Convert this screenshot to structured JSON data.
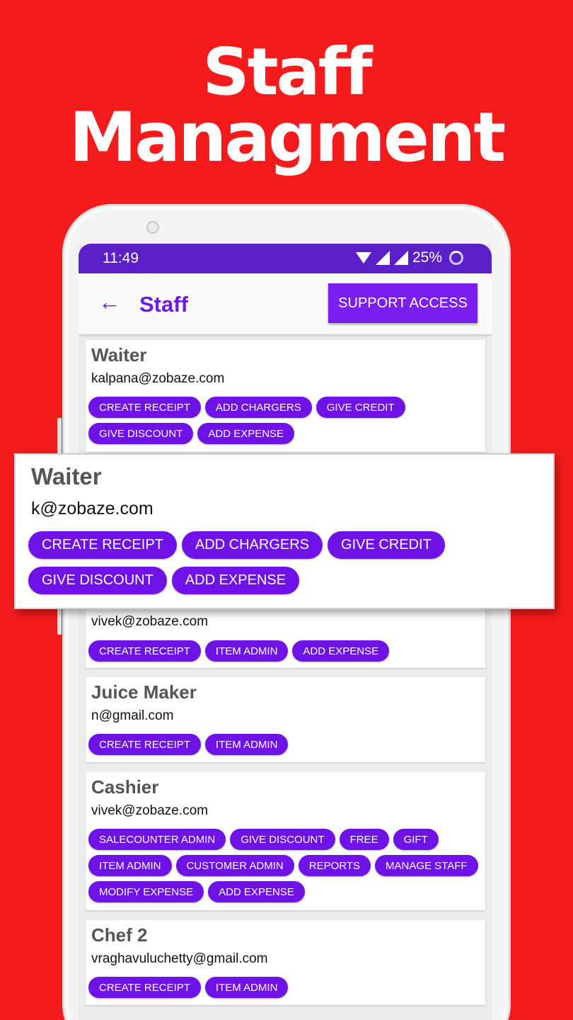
{
  "headline": {
    "line1": "Staff",
    "line2": "Managment"
  },
  "status_bar": {
    "time": "11:49",
    "battery": "25%"
  },
  "app_bar": {
    "back_label": "←",
    "title": "Staff",
    "support_button": "SUPPORT ACCESS"
  },
  "colors": {
    "background": "#f41b1c",
    "accent": "#6f12e8",
    "status_bar": "#5b1fc7",
    "title": "#6a1be8"
  },
  "staff": [
    {
      "role": "Waiter",
      "email": "kalpana@zobaze.com",
      "permissions": [
        "CREATE RECEIPT",
        "ADD CHARGERS",
        "GIVE CREDIT",
        "GIVE DISCOUNT",
        "ADD EXPENSE"
      ]
    },
    {
      "role": "",
      "email": "vivek@zobaze.com",
      "permissions": [
        "CREATE RECEIPT",
        "ITEM ADMIN",
        "ADD EXPENSE"
      ]
    },
    {
      "role": "Juice Maker",
      "email": "n@gmail.com",
      "permissions": [
        "CREATE RECEIPT",
        "ITEM ADMIN"
      ]
    },
    {
      "role": "Cashier",
      "email": "vivek@zobaze.com",
      "permissions": [
        "SALECOUNTER ADMIN",
        "GIVE DISCOUNT",
        "FREE",
        "GIFT",
        "ITEM ADMIN",
        "CUSTOMER ADMIN",
        "REPORTS",
        "MANAGE STAFF",
        "MODIFY EXPENSE",
        "ADD EXPENSE"
      ]
    },
    {
      "role": "Chef 2",
      "email": "vraghavuluchetty@gmail.com",
      "permissions": [
        "CREATE RECEIPT",
        "ITEM ADMIN"
      ]
    }
  ],
  "zoomed_card": {
    "role": "Waiter",
    "email": "k@zobaze.com",
    "permissions": [
      "CREATE RECEIPT",
      "ADD CHARGERS",
      "GIVE CREDIT",
      "GIVE DISCOUNT",
      "ADD EXPENSE"
    ]
  }
}
